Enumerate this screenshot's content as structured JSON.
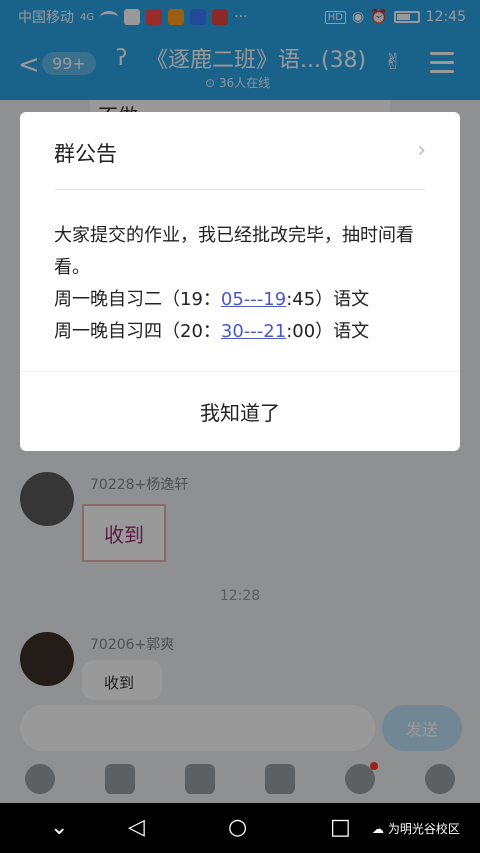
{
  "status_bar": {
    "carrier": "中国移动",
    "network": "4G",
    "more": "···",
    "time": "12:45",
    "hd": "HD"
  },
  "header": {
    "back_glyph": "<",
    "unread_badge": "99+",
    "title": "《逐鹿二班》语...(38)",
    "online_count": "36人在线",
    "colors": {
      "header_bg": "#2aa4e6"
    }
  },
  "chat": {
    "top_bubble_text": "不做。",
    "messages": [
      {
        "sender": "70228+杨逸轩",
        "sticker_text": "收到"
      },
      {
        "time": "12:28"
      },
      {
        "sender": "70206+郭爽",
        "text": "收到"
      }
    ]
  },
  "input_bar": {
    "placeholder": "",
    "send_label": "发送"
  },
  "toolbar": {
    "icons": [
      "microphone-icon",
      "image-icon",
      "camera-icon",
      "gift-icon",
      "emoji-icon",
      "plus-icon"
    ]
  },
  "announcement": {
    "title": "群公告",
    "line1": "大家提交的作业，我已经批改完毕，抽时间看看。",
    "line2_prefix": "周一晚自习二（19：",
    "line2_link": "05---19",
    "line2_suffix": ":45）语文",
    "line3_prefix": "周一晚自习四（20：",
    "line3_link": "30---21",
    "line3_suffix": ":00）语文",
    "confirm_label": "我知道了"
  },
  "nav_bar": {
    "watermark": "为明光谷校区"
  }
}
